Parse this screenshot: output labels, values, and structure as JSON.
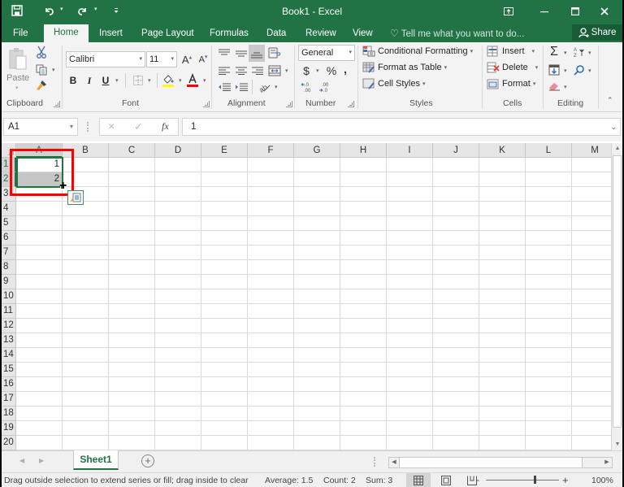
{
  "window": {
    "title": "Book1 - Excel",
    "controls": {
      "ribbon_display": "ribbon-display-options-icon",
      "minimize": "minimize-icon",
      "maximize": "maximize-icon",
      "close": "close-icon"
    }
  },
  "quick_access": {
    "save": "save-icon",
    "undo": "undo-icon",
    "redo": "redo-icon",
    "customize": "customize-qat-icon"
  },
  "tabs": [
    {
      "label": "File"
    },
    {
      "label": "Home",
      "active": true
    },
    {
      "label": "Insert"
    },
    {
      "label": "Page Layout"
    },
    {
      "label": "Formulas"
    },
    {
      "label": "Data"
    },
    {
      "label": "Review"
    },
    {
      "label": "View"
    }
  ],
  "tell_me": {
    "placeholder": "Tell me what you want to do..."
  },
  "share": {
    "label": "Share"
  },
  "ribbon": {
    "clipboard": {
      "label": "Clipboard",
      "paste": "Paste"
    },
    "font": {
      "label": "Font",
      "font_name": "Calibri",
      "font_size": "11",
      "bold": "B",
      "italic": "I",
      "underline": "U",
      "highlight_color": "#ffff00",
      "font_color": "#ff0000"
    },
    "alignment": {
      "label": "Alignment"
    },
    "number": {
      "label": "Number",
      "format": "General",
      "currency": "$",
      "percent": "%",
      "comma": ",",
      "increase_decimal": ".00",
      "decrease_decimal": ".0"
    },
    "styles": {
      "label": "Styles",
      "conditional_formatting": "Conditional Formatting",
      "format_as_table": "Format as Table",
      "cell_styles": "Cell Styles"
    },
    "cells": {
      "label": "Cells",
      "insert": "Insert",
      "delete": "Delete",
      "format": "Format"
    },
    "editing": {
      "label": "Editing"
    }
  },
  "formula_bar": {
    "name_box": "A1",
    "value": "1",
    "cancel": "×",
    "enter": "✓",
    "fx": "fx"
  },
  "grid": {
    "columns": [
      "A",
      "B",
      "C",
      "D",
      "E",
      "F",
      "G",
      "H",
      "I",
      "J",
      "K",
      "L",
      "M"
    ],
    "rows": [
      "1",
      "2",
      "3",
      "4",
      "5",
      "6",
      "7",
      "8",
      "9",
      "10",
      "11",
      "12",
      "13",
      "14",
      "15",
      "16",
      "17",
      "18",
      "19",
      "20"
    ],
    "cells": {
      "A1": "1",
      "A2": "2"
    },
    "selection": "A1:A2",
    "active_cell": "A1"
  },
  "sheets": [
    {
      "label": "Sheet1",
      "active": true
    }
  ],
  "status": {
    "message": "Drag outside selection to extend series or fill; drag inside to clear",
    "average": "Average: 1.5",
    "count": "Count: 2",
    "sum": "Sum: 3",
    "zoom": "100%",
    "zoom_minus": "-",
    "zoom_plus": "+"
  },
  "colors": {
    "accent": "#217346",
    "highlight_box": "#ff0000"
  }
}
